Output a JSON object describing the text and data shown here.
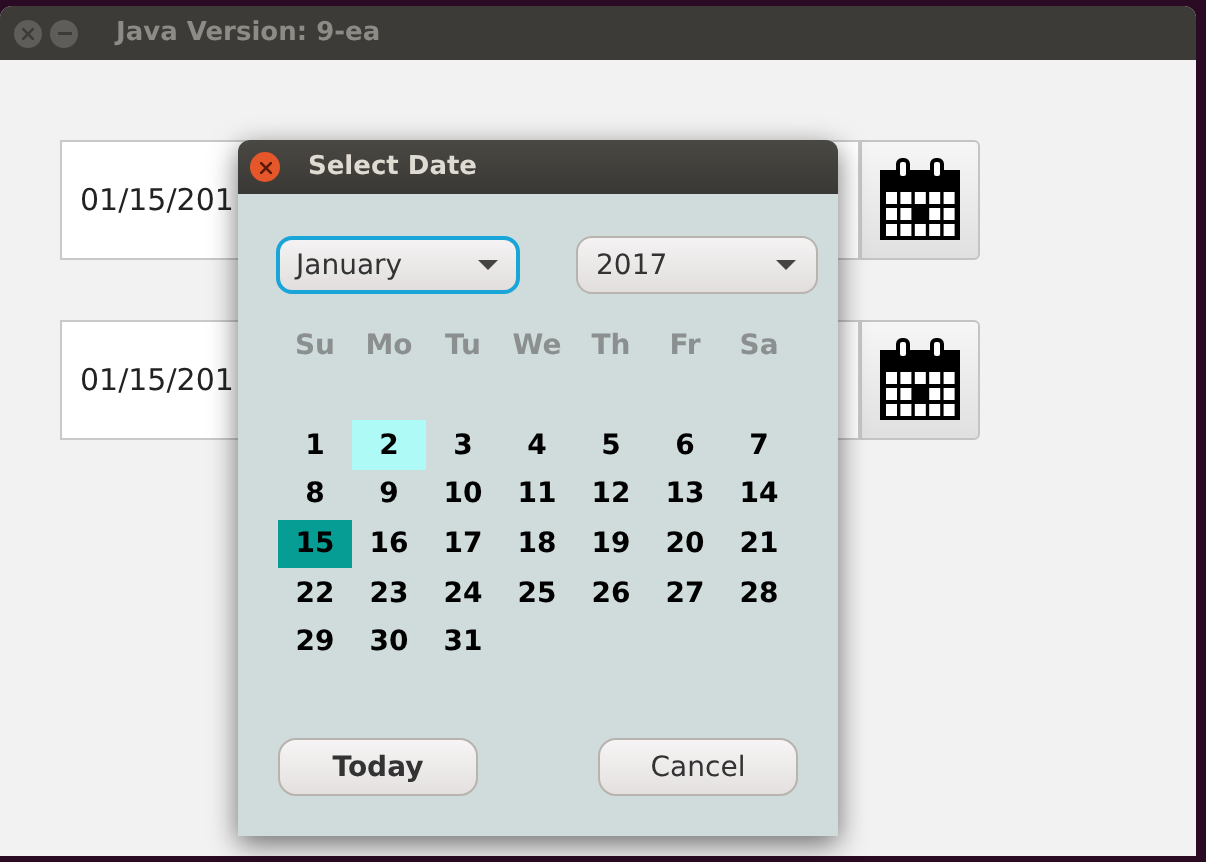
{
  "window": {
    "title": "Java Version: 9-ea"
  },
  "date_fields": [
    {
      "value": "01/15/201"
    },
    {
      "value": "01/15/201"
    }
  ],
  "dialog": {
    "title": "Select Date",
    "month": "January",
    "year": "2017",
    "weekdays": [
      "Su",
      "Mo",
      "Tu",
      "We",
      "Th",
      "Fr",
      "Sa"
    ],
    "days": [
      {
        "label": "1",
        "today": false,
        "selected": false
      },
      {
        "label": "2",
        "today": true,
        "selected": false
      },
      {
        "label": "3",
        "today": false,
        "selected": false
      },
      {
        "label": "4",
        "today": false,
        "selected": false
      },
      {
        "label": "5",
        "today": false,
        "selected": false
      },
      {
        "label": "6",
        "today": false,
        "selected": false
      },
      {
        "label": "7",
        "today": false,
        "selected": false
      },
      {
        "label": "8",
        "today": false,
        "selected": false
      },
      {
        "label": "9",
        "today": false,
        "selected": false
      },
      {
        "label": "10",
        "today": false,
        "selected": false
      },
      {
        "label": "11",
        "today": false,
        "selected": false
      },
      {
        "label": "12",
        "today": false,
        "selected": false
      },
      {
        "label": "13",
        "today": false,
        "selected": false
      },
      {
        "label": "14",
        "today": false,
        "selected": false
      },
      {
        "label": "15",
        "today": false,
        "selected": true
      },
      {
        "label": "16",
        "today": false,
        "selected": false
      },
      {
        "label": "17",
        "today": false,
        "selected": false
      },
      {
        "label": "18",
        "today": false,
        "selected": false
      },
      {
        "label": "19",
        "today": false,
        "selected": false
      },
      {
        "label": "20",
        "today": false,
        "selected": false
      },
      {
        "label": "21",
        "today": false,
        "selected": false
      },
      {
        "label": "22",
        "today": false,
        "selected": false
      },
      {
        "label": "23",
        "today": false,
        "selected": false
      },
      {
        "label": "24",
        "today": false,
        "selected": false
      },
      {
        "label": "25",
        "today": false,
        "selected": false
      },
      {
        "label": "26",
        "today": false,
        "selected": false
      },
      {
        "label": "27",
        "today": false,
        "selected": false
      },
      {
        "label": "28",
        "today": false,
        "selected": false
      },
      {
        "label": "29",
        "today": false,
        "selected": false
      },
      {
        "label": "30",
        "today": false,
        "selected": false
      },
      {
        "label": "31",
        "today": false,
        "selected": false
      }
    ],
    "buttons": [
      {
        "label": "Today",
        "bold": true
      },
      {
        "label": "Cancel",
        "bold": false
      }
    ]
  }
}
